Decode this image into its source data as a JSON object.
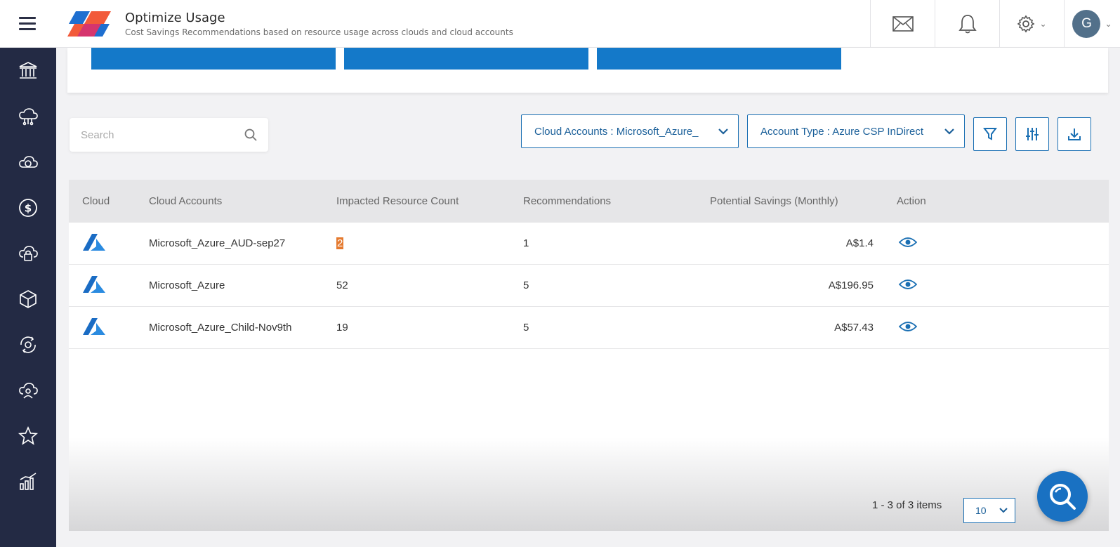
{
  "header": {
    "title": "Optimize Usage",
    "subtitle": "Cost Savings Recommendations based on resource usage across clouds and cloud accounts",
    "avatar_initial": "G"
  },
  "sidebar": {
    "items": [
      {
        "icon": "bank-icon"
      },
      {
        "icon": "cloud-network-icon"
      },
      {
        "icon": "cloud-sync-icon"
      },
      {
        "icon": "dollar-icon"
      },
      {
        "icon": "cloud-lock-icon"
      },
      {
        "icon": "cube-icon"
      },
      {
        "icon": "gear-cycle-icon"
      },
      {
        "icon": "cloud-user-icon"
      },
      {
        "icon": "star-icon"
      },
      {
        "icon": "bar-chart-icon"
      }
    ]
  },
  "search": {
    "placeholder": "Search"
  },
  "filters": {
    "cloud_accounts": "Cloud Accounts : Microsoft_Azure_",
    "account_type": "Account Type : Azure CSP InDirect"
  },
  "table": {
    "headers": {
      "cloud": "Cloud",
      "accounts": "Cloud Accounts",
      "count": "Impacted Resource Count",
      "recommendations": "Recommendations",
      "savings": "Potential Savings (Monthly)",
      "action": "Action"
    },
    "rows": [
      {
        "account": "Microsoft_Azure_AUD-sep27",
        "count": "2",
        "recommendations": "1",
        "savings": "A$1.4"
      },
      {
        "account": "Microsoft_Azure",
        "count": "52",
        "recommendations": "5",
        "savings": "A$196.95"
      },
      {
        "account": "Microsoft_Azure_Child-Nov9th",
        "count": "19",
        "recommendations": "5",
        "savings": "A$57.43"
      }
    ]
  },
  "pager": {
    "summary": "1 - 3 of 3 items",
    "page_size": "10"
  },
  "colors": {
    "primary": "#1479c9",
    "sidebar": "#232a44",
    "highlight": "#e57a2f"
  }
}
